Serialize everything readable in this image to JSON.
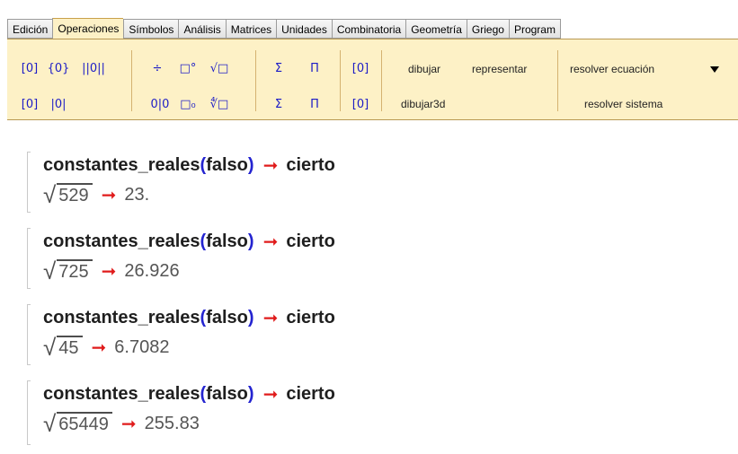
{
  "tabs": [
    "Edición",
    "Operaciones",
    "Símbolos",
    "Análisis",
    "Matrices",
    "Unidades",
    "Combinatoria",
    "Geometría",
    "Griego",
    "Program"
  ],
  "active_tab": "Operaciones",
  "toolbar": {
    "icons_row1": [
      "[0]",
      "{0}",
      "||0||",
      "÷",
      "□°",
      "√□",
      "Σ",
      "Π",
      "[0]"
    ],
    "icons_row2": [
      "[0]",
      "|0|",
      "0|0",
      "□₀",
      "∜□",
      "Σ̄",
      "Π̄",
      "[0]"
    ],
    "buttons": {
      "dibujar": "dibujar",
      "representar": "representar",
      "dibujar3d": "dibujar3d",
      "resolver_ecuacion": "resolver ecuación",
      "resolver_sistema": "resolver sistema"
    }
  },
  "entries": [
    {
      "fn": "constantes_reales",
      "arg": "falso",
      "result": "cierto",
      "radicand": "529",
      "value": "23."
    },
    {
      "fn": "constantes_reales",
      "arg": "falso",
      "result": "cierto",
      "radicand": "725",
      "value": "26.926"
    },
    {
      "fn": "constantes_reales",
      "arg": "falso",
      "result": "cierto",
      "radicand": "45",
      "value": "6.7082"
    },
    {
      "fn": "constantes_reales",
      "arg": "falso",
      "result": "cierto",
      "radicand": "65449",
      "value": "255.83"
    }
  ],
  "symbols": {
    "open_paren": "(",
    "close_paren": ")",
    "arrow": "➞",
    "sqrt": "√"
  },
  "colors": {
    "toolbar_bg": "#fdf1c6",
    "arrow": "#e01b1b",
    "paren": "#2424d0",
    "icon": "#1c1cc6"
  }
}
